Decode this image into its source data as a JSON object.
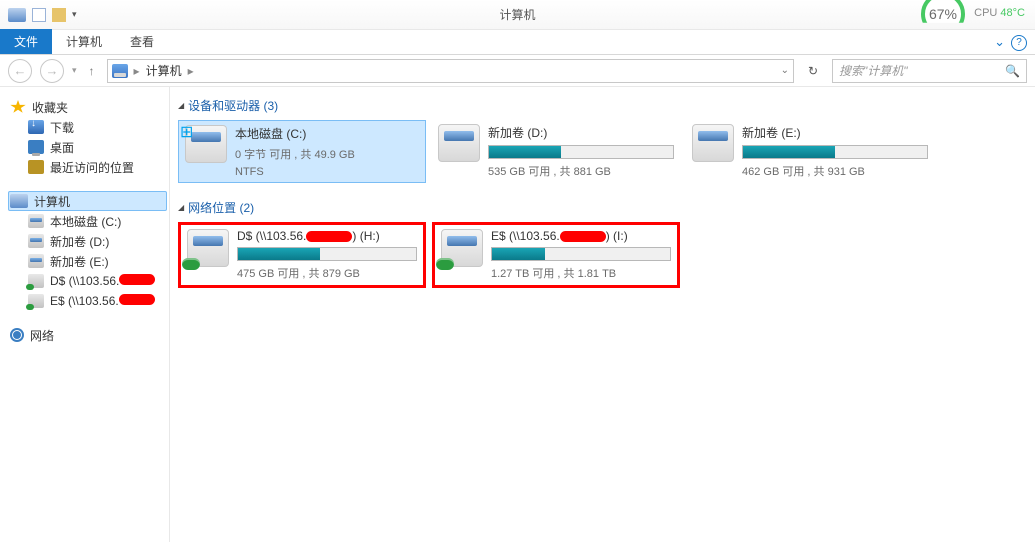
{
  "titlebar": {
    "title": "计算机"
  },
  "gauge": {
    "percent": "67%",
    "cpu_label": "CPU",
    "cpu_temp": "48°C"
  },
  "ribbon": {
    "file": "文件",
    "computer": "计算机",
    "view": "查看"
  },
  "address": {
    "location": "计算机"
  },
  "search": {
    "placeholder": "搜索\"计算机\""
  },
  "sidebar": {
    "favorites": {
      "label": "收藏夹",
      "download": "下载",
      "desktop": "桌面",
      "recent": "最近访问的位置"
    },
    "computer": {
      "label": "计算机",
      "local_c": "本地磁盘 (C:)",
      "vol_d": "新加卷 (D:)",
      "vol_e": "新加卷 (E:)",
      "net_d_prefix": "D$ (\\\\103.56.",
      "net_e_prefix": "E$ (\\\\103.56."
    },
    "network": {
      "label": "网络"
    }
  },
  "content": {
    "group_devices": "设备和驱动器 (3)",
    "group_network": "网络位置 (2)",
    "drives": {
      "c": {
        "name": "本地磁盘 (C:)",
        "line1": "0 字节 可用 , 共 49.9 GB",
        "line2": "NTFS"
      },
      "d": {
        "name": "新加卷 (D:)",
        "stat": "535 GB 可用 , 共 881 GB",
        "fill_pct": 39
      },
      "e": {
        "name": "新加卷 (E:)",
        "stat": "462 GB 可用 , 共 931 GB",
        "fill_pct": 50
      },
      "nd": {
        "prefix": "D$ (\\\\103.56.",
        "suffix": ") (H:)",
        "stat": "475 GB 可用 , 共 879 GB",
        "fill_pct": 46
      },
      "ne": {
        "prefix": "E$ (\\\\103.56.",
        "suffix": ") (I:)",
        "stat": "1.27 TB 可用 , 共 1.81 TB",
        "fill_pct": 30
      }
    }
  }
}
